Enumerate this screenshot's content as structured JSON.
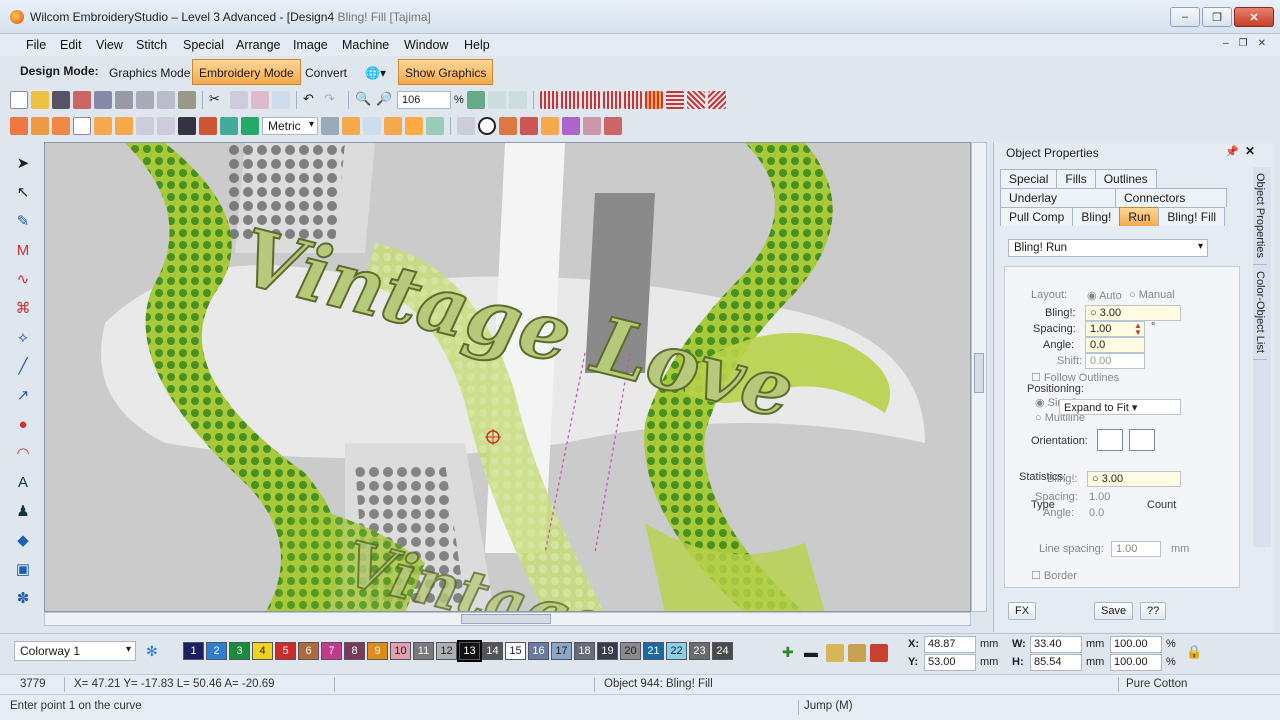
{
  "window": {
    "title": "Wilcom EmbroideryStudio – Level 3 Advanced - [Design4",
    "title_overlay": "Bling! Fill [Tajima]",
    "minimize": "‒",
    "maximize": "❐",
    "close": "✕"
  },
  "menu": [
    "File",
    "Edit",
    "View",
    "Stitch",
    "Special",
    "Arrange",
    "Image",
    "Machine",
    "Window",
    "Help"
  ],
  "mdi_controls": [
    "‒",
    "❐",
    "✕"
  ],
  "modebar": {
    "label": "Design Mode:",
    "graphics_mode": "Graphics Mode",
    "embroidery_mode": "Embroidery Mode",
    "convert": "Convert",
    "show_graphics": "Show Graphics"
  },
  "toolbar": {
    "zoom_value": "106",
    "zoom_unit": "%",
    "units": "Metric"
  },
  "canvas": {
    "text_main": "Vintage Love",
    "text_secondary": "Vintage"
  },
  "panel": {
    "title": "Object Properties",
    "side_tabs": [
      "Object Properties",
      "Color-Object List"
    ],
    "tabs_row1": [
      "Special",
      "Fills",
      "Outlines"
    ],
    "tabs_row2": [
      "Underlay",
      "Connectors"
    ],
    "tabs_row3": [
      "Pull Comp",
      "Bling!",
      "Run",
      "Bling! Fill"
    ],
    "type_select": "Bling! Run",
    "layout_label": "Layout:",
    "layout_auto": "Auto",
    "layout_manual": "Manual",
    "bling_label": "Bling!:",
    "bling_value": "3.00",
    "spacing_label": "Spacing:",
    "spacing_value": "1.00",
    "spacing_unit": "°",
    "angle_label": "Angle:",
    "angle_value": "0.0",
    "shift_label": "Shift:",
    "shift_value": "0.00",
    "follow_outlines": "Follow Outlines",
    "positioning_label": "Positioning:",
    "pos_simple": "Simple",
    "pos_multiline": "Multiline",
    "expand_select": "Expand to Fit",
    "orientation_label": "Orientation:",
    "statistics_label": "Statistics:",
    "stat_bling_label": "Bling!:",
    "stat_bling_value": "3.00",
    "stat_spacing_label": "Spacing:",
    "stat_spacing_value": "1.00",
    "stat_angle_label": "Angle:",
    "stat_angle_value": "0.0",
    "type_col": "Type",
    "count_col": "Count",
    "line_spacing_label": "Line spacing:",
    "line_spacing_value": "1.00",
    "line_spacing_unit": "mm",
    "border_label": "Border",
    "fx_button": "FX",
    "save_button": "Save",
    "help_button": "??"
  },
  "colorbar": {
    "colorway": "Colorway 1",
    "swatches": [
      {
        "n": "1",
        "color": "#1a1f5e"
      },
      {
        "n": "2",
        "color": "#2a7fd4"
      },
      {
        "n": "3",
        "color": "#1b8a3a"
      },
      {
        "n": "4",
        "color": "#f2d21a"
      },
      {
        "n": "5",
        "color": "#cf2a2a"
      },
      {
        "n": "6",
        "color": "#b06a3a"
      },
      {
        "n": "7",
        "color": "#c23a8a"
      },
      {
        "n": "8",
        "color": "#7a3a5a"
      },
      {
        "n": "9",
        "color": "#e08a1a"
      },
      {
        "n": "10",
        "color": "#e0a0b0"
      },
      {
        "n": "11",
        "color": "#7a7a7a"
      },
      {
        "n": "12",
        "color": "#b0b0b0"
      },
      {
        "n": "13",
        "color": "#111111"
      },
      {
        "n": "14",
        "color": "#555555"
      },
      {
        "n": "15",
        "color": "#ffffff"
      },
      {
        "n": "16",
        "color": "#6a7aa0"
      },
      {
        "n": "17",
        "color": "#8aa6c8"
      },
      {
        "n": "18",
        "color": "#6a6a7a"
      },
      {
        "n": "19",
        "color": "#3a3a4a"
      },
      {
        "n": "20",
        "color": "#8a8a8a"
      },
      {
        "n": "21",
        "color": "#1a6aa0"
      },
      {
        "n": "22",
        "color": "#8ad0e8"
      },
      {
        "n": "23",
        "color": "#6a6a6a"
      },
      {
        "n": "24",
        "color": "#4a4a4a"
      }
    ],
    "x_label": "X:",
    "x_value": "48.87",
    "y_label": "Y:",
    "y_value": "53.00",
    "w_label": "W:",
    "w_value": "33.40",
    "h_label": "H:",
    "h_value": "85.54",
    "mm": "mm",
    "pct_w": "100.00",
    "pct_h": "100.00",
    "pct": "%"
  },
  "status": {
    "stitches": "3779",
    "coords": "X=  47.21 Y= -17.83 L=  50.46 A= -20.69",
    "object": "Object 944: Bling! Fill",
    "fabric": "Pure Cotton",
    "prompt": "Enter point 1 on the curve",
    "jump": "Jump (M)"
  },
  "colors": {
    "accent_orange": "#f6a94a",
    "chrome": "#dfe6ee",
    "embroidery_green": "#a8c93a",
    "dot_green": "#3d8a1c"
  }
}
